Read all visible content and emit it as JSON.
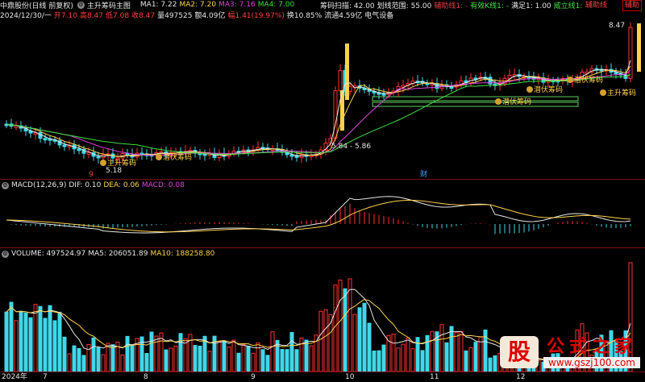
{
  "header": {
    "stock_name": "中鼎股份(日线 前复权)",
    "indicator_title": "主升筹码主图",
    "ma": [
      {
        "label": "MA1: 7.22",
        "color": "#e6e6e6"
      },
      {
        "label": "MA2: 7.20",
        "color": "#ffd24d"
      },
      {
        "label": "MA3: 7.16",
        "color": "#e040e0"
      },
      {
        "label": "MA4: 7.00",
        "color": "#40e040"
      }
    ],
    "right_items": [
      {
        "label": "筹码扫描: 42.00",
        "color": "#e6e6e6"
      },
      {
        "label": "划线范围: 55.00",
        "color": "#e6e6e6"
      },
      {
        "label": "辅助线1: -",
        "color": "#e04040"
      },
      {
        "label": "有效K线1: -",
        "color": "#40e040"
      },
      {
        "label": "满足1: 1.00",
        "color": "#e6e6e6"
      },
      {
        "label": "威立线1: -",
        "color": "#40e040"
      }
    ],
    "right_badge": "辅助",
    "info": [
      {
        "label": "2024/12/30/一",
        "color": "#e6e6e6"
      },
      {
        "label": "开7.10",
        "color": "#ff4040"
      },
      {
        "label": "高8.47",
        "color": "#ff4040"
      },
      {
        "label": "低7.08",
        "color": "#ff4040"
      },
      {
        "label": "收8.47",
        "color": "#ff4040"
      },
      {
        "label": "量497525",
        "color": "#e6e6e6"
      },
      {
        "label": "额4.09亿",
        "color": "#e6e6e6"
      },
      {
        "label": "幅1.41(19.97%)",
        "color": "#ff4040"
      },
      {
        "label": "换10.85%",
        "color": "#e6e6e6"
      },
      {
        "label": "流通4.59亿",
        "color": "#e6e6e6"
      },
      {
        "label": "电气设备",
        "color": "#e6e6e6"
      }
    ]
  },
  "price_annotations": {
    "high_label": "8.47",
    "range_label": "5.84 - 5.86",
    "low_label": "5.18",
    "event_label": "财",
    "red_mark": "9"
  },
  "badges": [
    {
      "text": "主升筹码"
    },
    {
      "text": "潜伏筹码"
    },
    {
      "text": "潜伏筹码"
    },
    {
      "text": "潜伏筹码"
    },
    {
      "text": "潜伏筹码"
    },
    {
      "text": "主升筹码"
    }
  ],
  "macd_header": [
    {
      "label": "MACD(12,26,9)",
      "color": "#e6e6e6"
    },
    {
      "label": "DIF: 0.10",
      "color": "#e6e6e6"
    },
    {
      "label": "DEA: 0.06",
      "color": "#ffd24d"
    },
    {
      "label": "MACD: 0.08",
      "color": "#e040e0"
    }
  ],
  "volume_header": [
    {
      "label": "VOLUME: 497524.97",
      "color": "#e6e6e6"
    },
    {
      "label": "MA5: 206051.89",
      "color": "#e6e6e6"
    },
    {
      "label": "MA10: 188258.80",
      "color": "#ffd24d"
    }
  ],
  "right_top_label": "辅助线",
  "x_axis": {
    "ticks": [
      "2024年",
      "7",
      "8",
      "9",
      "10",
      "11",
      "12"
    ]
  },
  "watermark": {
    "logo": "股",
    "title": "公式之家",
    "url": "www.gszj100.com"
  },
  "colors": {
    "up": "#ff3232",
    "down": "#40d8e8",
    "ma1": "#e6e6e6",
    "ma2": "#ffd24d",
    "ma3": "#e040e0",
    "ma4": "#40e040"
  }
}
